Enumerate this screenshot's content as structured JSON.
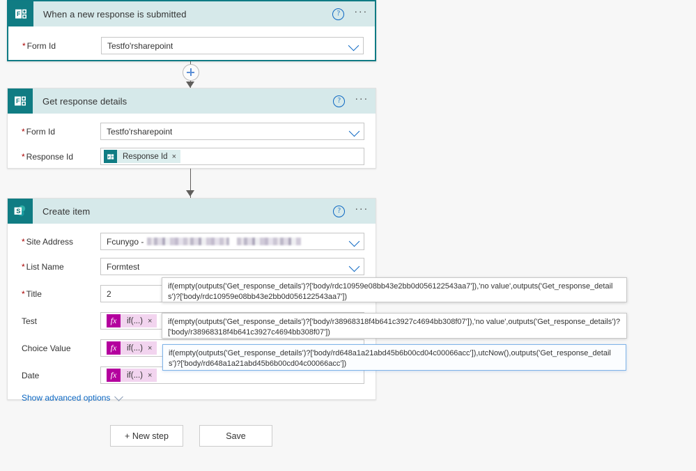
{
  "theme": {
    "accent_teal": "#107c83",
    "header_bg": "#d6e9ea",
    "link_blue": "#0a66c2",
    "required_red": "#a80000",
    "fx_magenta": "#b4009e",
    "canvas_bg": "#f7f7f7"
  },
  "cards": [
    {
      "id": "trigger",
      "icon": "microsoft-forms-icon",
      "title": "When a new response is submitted",
      "help_label": "?",
      "more_label": "···",
      "fields": [
        {
          "label": "Form Id",
          "required": true,
          "value": "Testfo'rsharepoint",
          "control": "dropdown"
        }
      ]
    },
    {
      "id": "get-response-details",
      "icon": "microsoft-forms-icon",
      "title": "Get response details",
      "help_label": "?",
      "more_label": "···",
      "fields": [
        {
          "label": "Form Id",
          "required": true,
          "value": "Testfo'rsharepoint",
          "control": "dropdown"
        },
        {
          "label": "Response Id",
          "required": true,
          "control": "token",
          "token_label": "Response Id",
          "token_remove": "×",
          "token_icon": "microsoft-forms-token-icon"
        }
      ]
    },
    {
      "id": "create-item",
      "icon": "sharepoint-icon",
      "title": "Create item",
      "help_label": "?",
      "more_label": "···",
      "fields": [
        {
          "label": "Site Address",
          "required": true,
          "value": "Fcunygo - ",
          "redacted": true,
          "control": "dropdown"
        },
        {
          "label": "List Name",
          "required": true,
          "value": "Formtest",
          "control": "dropdown"
        },
        {
          "label": "Title",
          "required": true,
          "value": "2",
          "control": "text"
        },
        {
          "label": "Test",
          "required": false,
          "control": "fx-token",
          "token_label": "if(...)",
          "token_remove": "×",
          "fx_label": "fx"
        },
        {
          "label": "Choice Value",
          "required": false,
          "control": "fx-token",
          "token_label": "if(...)",
          "token_remove": "×",
          "fx_label": "fx"
        },
        {
          "label": "Date",
          "required": false,
          "control": "fx-token",
          "token_label": "if(...)",
          "token_remove": "×",
          "fx_label": "fx"
        }
      ],
      "advanced_label": "Show advanced options"
    }
  ],
  "tooltips": [
    {
      "id": "tooltip-title",
      "active": false,
      "text": "if(empty(outputs('Get_response_details')?['body/rdc10959e08bb43e2bb0d056122543aa7']),'no value',outputs('Get_response_details')?['body/rdc10959e08bb43e2bb0d056122543aa7'])"
    },
    {
      "id": "tooltip-choice-value",
      "active": false,
      "text": "if(empty(outputs('Get_response_details')?['body/r38968318f4b641c3927c4694bb308f07']),'no value',outputs('Get_response_details')?['body/r38968318f4b641c3927c4694bb308f07'])"
    },
    {
      "id": "tooltip-date",
      "active": true,
      "text": "if(empty(outputs('Get_response_details')?['body/rd648a1a21abd45b6b00cd04c00066acc']),utcNow(),outputs('Get_response_details')?['body/rd648a1a21abd45b6b00cd04c00066acc'])"
    }
  ],
  "buttons": {
    "new_step": "+ New step",
    "save": "Save"
  }
}
